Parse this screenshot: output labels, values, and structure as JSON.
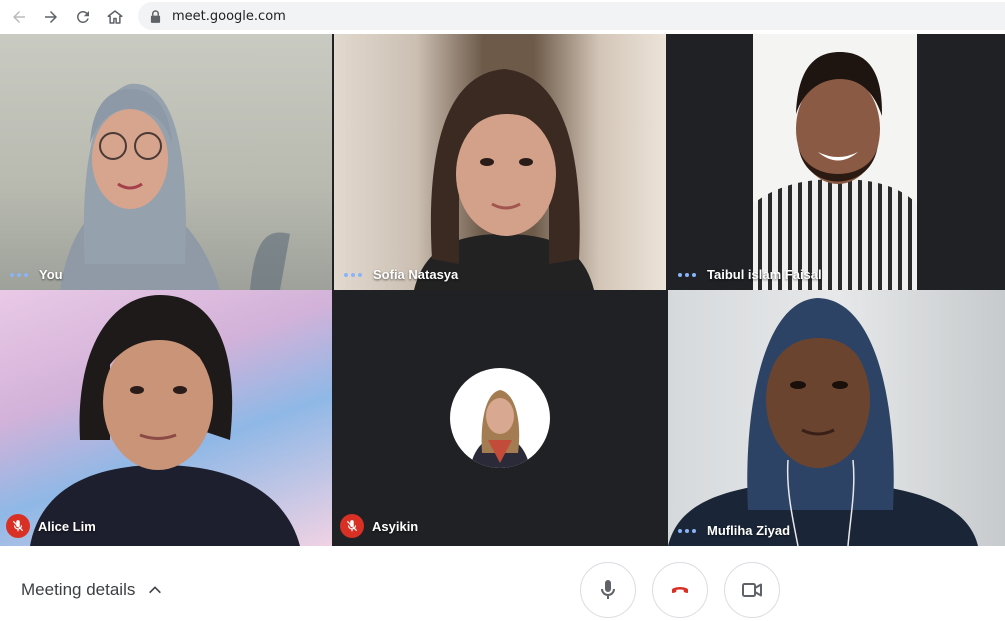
{
  "browser": {
    "url": "meet.google.com",
    "icons": [
      "back-arrow-icon",
      "forward-arrow-icon",
      "reload-icon",
      "home-icon",
      "lock-icon"
    ]
  },
  "participants": [
    {
      "name": "You",
      "mic": "speaking"
    },
    {
      "name": "Sofia Natasya",
      "mic": "speaking"
    },
    {
      "name": "Taibul islam Faisal",
      "mic": "speaking"
    },
    {
      "name": "Alice Lim",
      "mic": "muted"
    },
    {
      "name": "Asyikin",
      "mic": "muted",
      "camera": "off"
    },
    {
      "name": "Mufliha Ziyad",
      "mic": "speaking"
    }
  ],
  "bottom_bar": {
    "meeting_details_label": "Meeting details",
    "controls": [
      "microphone-icon",
      "hang-up-icon",
      "camera-icon"
    ]
  },
  "colors": {
    "tile_background": "#202124",
    "muted_badge": "#d93025",
    "speaking_dots": "#8ab4f8",
    "hang_up": "#d93025"
  }
}
